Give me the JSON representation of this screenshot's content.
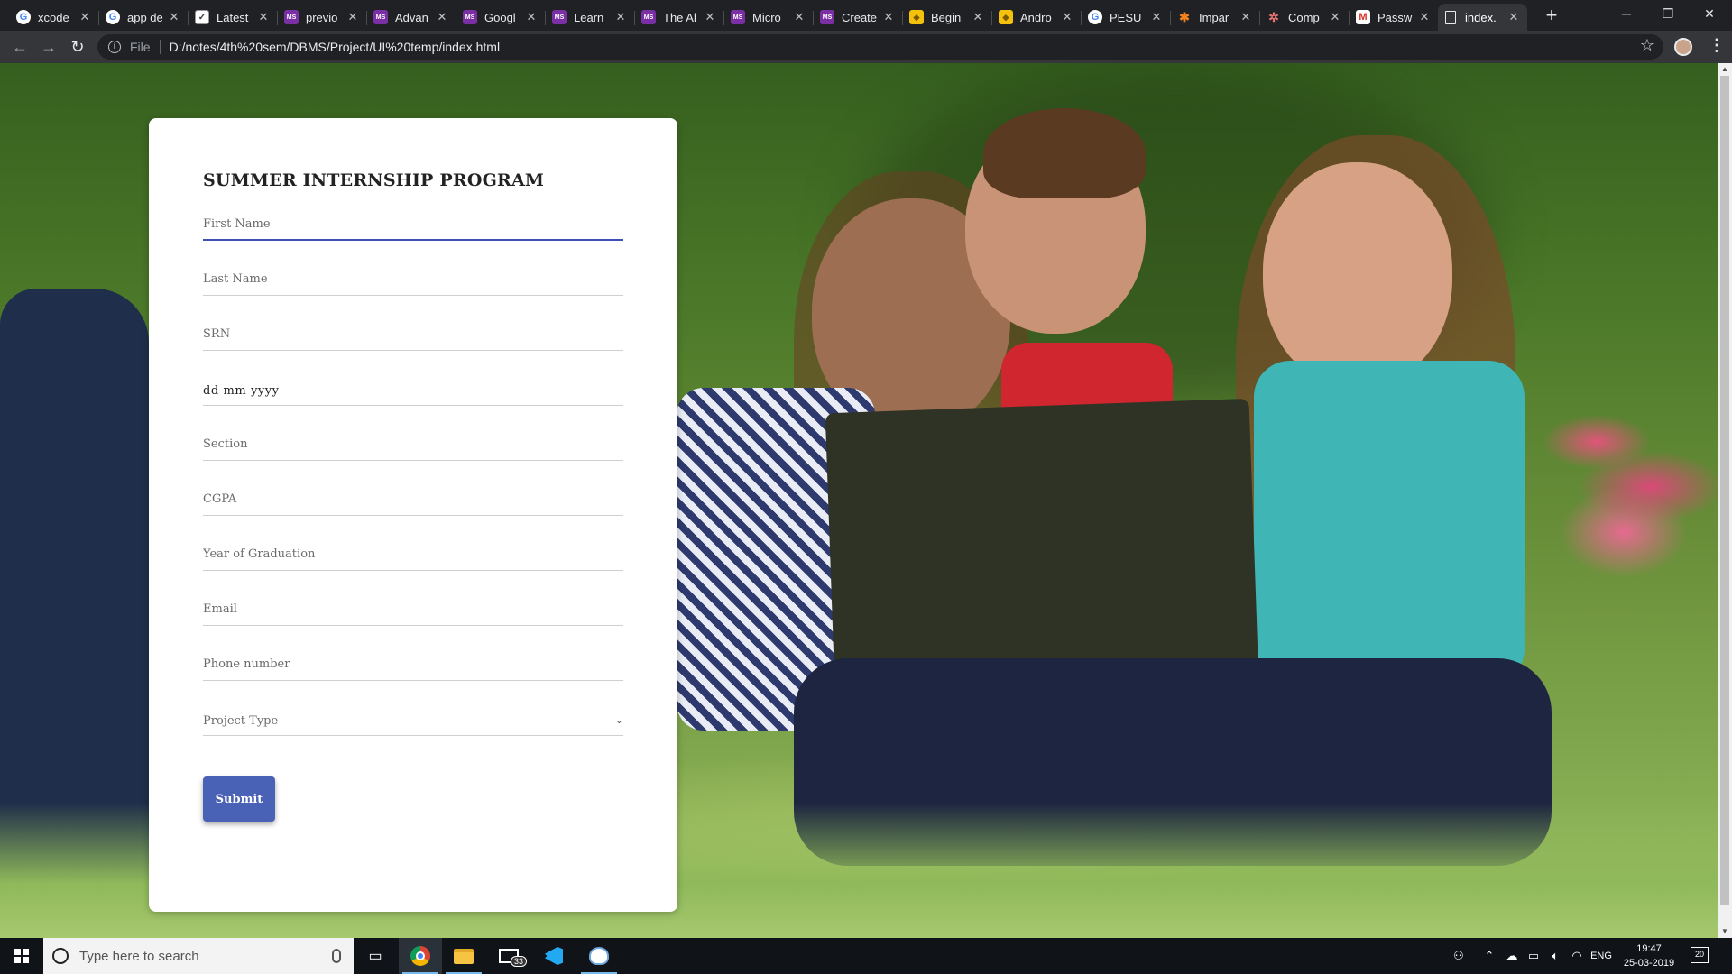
{
  "browser": {
    "tabs": [
      {
        "title": "xcode",
        "icon": "google-icon"
      },
      {
        "title": "app de",
        "icon": "google-icon"
      },
      {
        "title": "Latest",
        "icon": "notebook-icon"
      },
      {
        "title": "previo",
        "icon": "ms-icon"
      },
      {
        "title": "Advan",
        "icon": "ms-icon"
      },
      {
        "title": "Googl",
        "icon": "ms-icon"
      },
      {
        "title": "Learn",
        "icon": "ms-icon"
      },
      {
        "title": "The Al",
        "icon": "ms-icon"
      },
      {
        "title": "Micro",
        "icon": "ms-icon"
      },
      {
        "title": "Create",
        "icon": "ms-icon"
      },
      {
        "title": "Begin",
        "icon": "yellow-icon"
      },
      {
        "title": "Andro",
        "icon": "yellow-icon"
      },
      {
        "title": "PESU",
        "icon": "google-icon"
      },
      {
        "title": "Impar",
        "icon": "star-icon"
      },
      {
        "title": "Comp",
        "icon": "gear-icon"
      },
      {
        "title": "Passw",
        "icon": "gmail-icon"
      },
      {
        "title": "index.",
        "icon": "page-icon",
        "active": true
      }
    ],
    "scheme_label": "File",
    "url": "D:/notes/4th%20sem/DBMS/Project/UI%20temp/index.html"
  },
  "form": {
    "title": "SUMMER INTERNSHIP PROGRAM",
    "first_name_placeholder": "First Name",
    "last_name_placeholder": "Last Name",
    "srn_placeholder": "SRN",
    "dob_value": "dd-mm-yyyy",
    "section_placeholder": "Section",
    "cgpa_placeholder": "CGPA",
    "graduation_placeholder": "Year of Graduation",
    "email_placeholder": "Email",
    "phone_placeholder": "Phone number",
    "project_type_placeholder": "Project Type",
    "submit_label": "Submit"
  },
  "taskbar": {
    "search_placeholder": "Type here to search",
    "mail_badge": "33",
    "language": "ENG",
    "time": "19:47",
    "date": "25-03-2019",
    "notifications": "20"
  },
  "colors": {
    "accent": "#3f51b5",
    "submit_bg": "#4a62b5",
    "tab_strip": "#202124",
    "toolbar": "#35363a",
    "taskbar": "#101418"
  }
}
